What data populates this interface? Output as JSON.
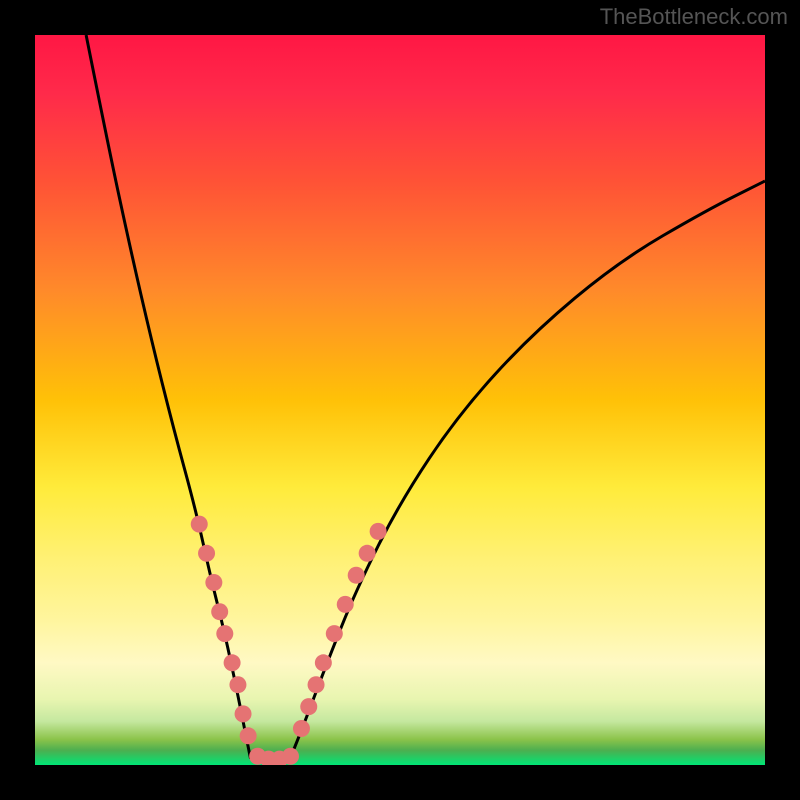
{
  "watermark": "TheBottleneck.com",
  "chart_data": {
    "type": "line",
    "title": "",
    "xlabel": "",
    "ylabel": "",
    "xlim": [
      0,
      100
    ],
    "ylim": [
      0,
      100
    ],
    "gradient_stops": [
      {
        "offset": 0,
        "color": "#ff1744"
      },
      {
        "offset": 8,
        "color": "#ff2a4a"
      },
      {
        "offset": 20,
        "color": "#ff5236"
      },
      {
        "offset": 35,
        "color": "#ff8a2a"
      },
      {
        "offset": 50,
        "color": "#ffc107"
      },
      {
        "offset": 62,
        "color": "#ffeb3b"
      },
      {
        "offset": 72,
        "color": "#fff176"
      },
      {
        "offset": 80,
        "color": "#fff59d"
      },
      {
        "offset": 86,
        "color": "#fff9c4"
      },
      {
        "offset": 91,
        "color": "#e8f5b0"
      },
      {
        "offset": 94,
        "color": "#c5e8a0"
      },
      {
        "offset": 96.5,
        "color": "#8bc34a"
      },
      {
        "offset": 98,
        "color": "#4caf50"
      },
      {
        "offset": 100,
        "color": "#00e676"
      }
    ],
    "series": [
      {
        "name": "left-branch",
        "x": [
          7,
          10,
          13,
          16,
          19,
          22,
          24,
          26,
          27.5,
          28.5,
          29.5
        ],
        "y": [
          100,
          85,
          71,
          58,
          46,
          35,
          26,
          18,
          11,
          6,
          1
        ]
      },
      {
        "name": "bottom-flat",
        "x": [
          29.5,
          31,
          33,
          35
        ],
        "y": [
          1,
          0.5,
          0.5,
          1
        ]
      },
      {
        "name": "right-branch",
        "x": [
          35,
          37,
          40,
          44,
          50,
          58,
          68,
          80,
          92,
          100
        ],
        "y": [
          1,
          6,
          14,
          24,
          36,
          48,
          59,
          69,
          76,
          80
        ]
      }
    ],
    "markers_left": [
      {
        "x": 22.5,
        "y": 33
      },
      {
        "x": 23.5,
        "y": 29
      },
      {
        "x": 24.5,
        "y": 25
      },
      {
        "x": 25.3,
        "y": 21
      },
      {
        "x": 26,
        "y": 18
      },
      {
        "x": 27,
        "y": 14
      },
      {
        "x": 27.8,
        "y": 11
      },
      {
        "x": 28.5,
        "y": 7
      },
      {
        "x": 29.2,
        "y": 4
      }
    ],
    "markers_bottom": [
      {
        "x": 30.5,
        "y": 1.2
      },
      {
        "x": 32,
        "y": 0.8
      },
      {
        "x": 33.5,
        "y": 0.8
      },
      {
        "x": 35,
        "y": 1.2
      }
    ],
    "markers_right": [
      {
        "x": 36.5,
        "y": 5
      },
      {
        "x": 37.5,
        "y": 8
      },
      {
        "x": 38.5,
        "y": 11
      },
      {
        "x": 39.5,
        "y": 14
      },
      {
        "x": 41,
        "y": 18
      },
      {
        "x": 42.5,
        "y": 22
      },
      {
        "x": 44,
        "y": 26
      },
      {
        "x": 45.5,
        "y": 29
      },
      {
        "x": 47,
        "y": 32
      }
    ],
    "marker_color": "#e57373",
    "marker_radius": 8.5
  }
}
